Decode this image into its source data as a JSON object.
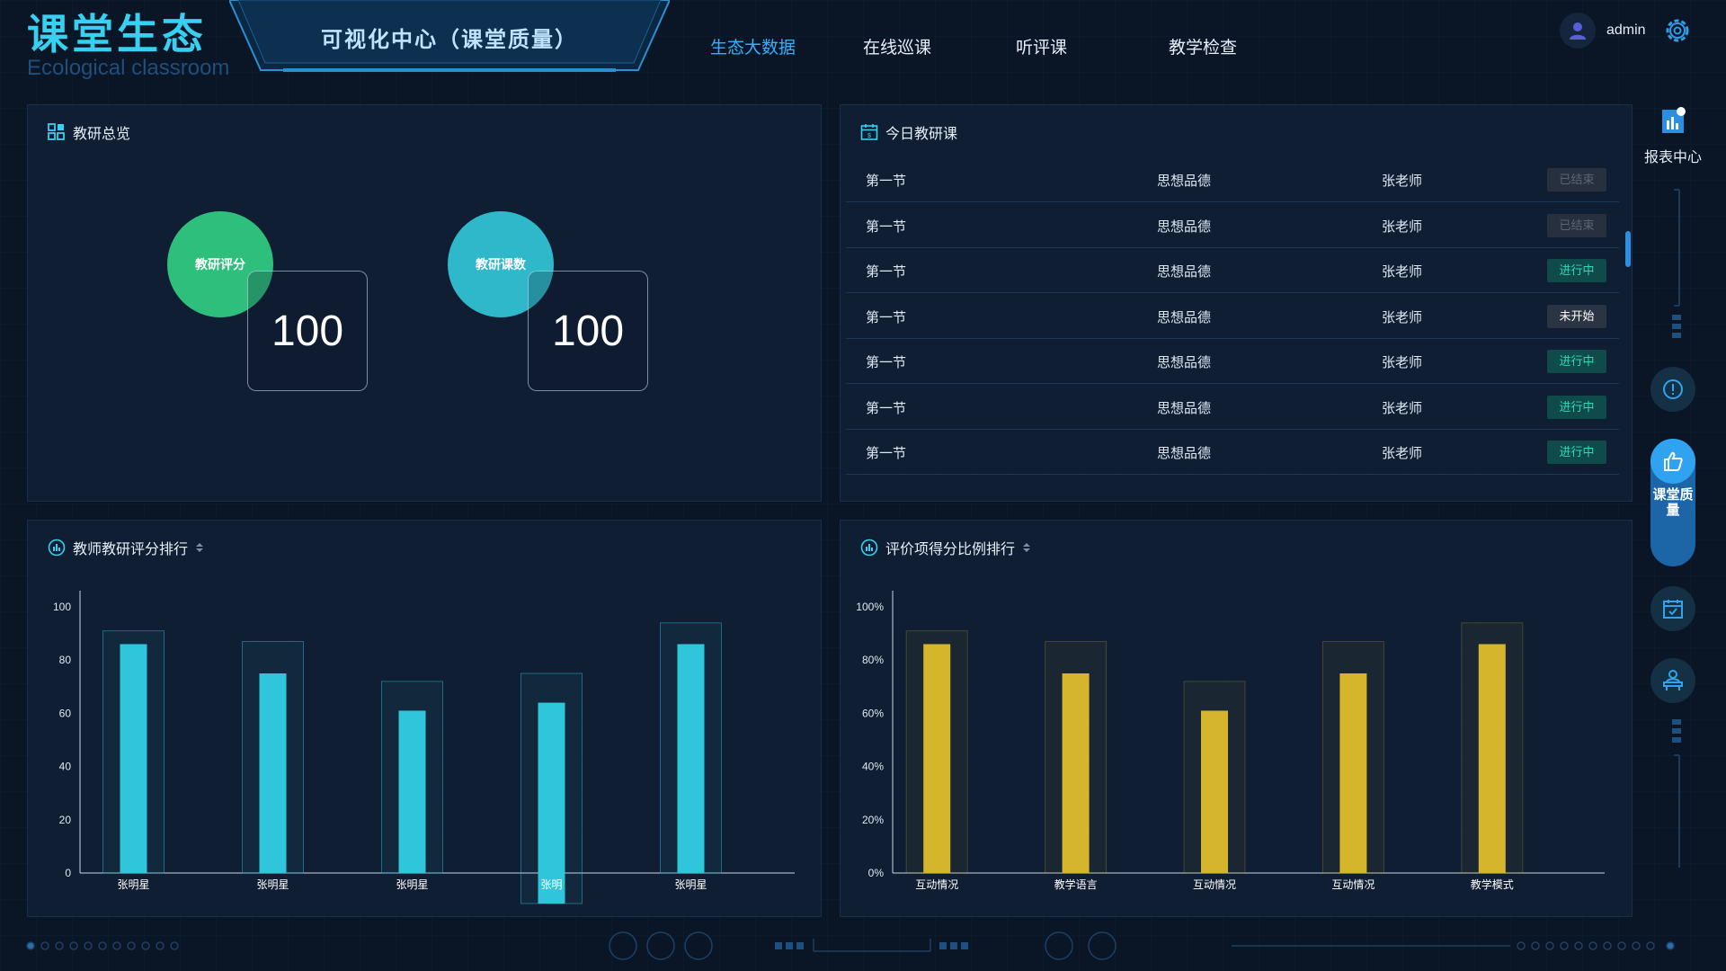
{
  "header": {
    "brand_title": "课堂生态",
    "brand_subtitle": "Ecological classroom",
    "center_title": "可视化中心（课堂质量）",
    "nav": [
      {
        "label": "生态大数据",
        "active": true
      },
      {
        "label": "在线巡课",
        "active": false
      },
      {
        "label": "听评课",
        "active": false
      },
      {
        "label": "教学检查",
        "active": false
      }
    ],
    "user_name": "admin"
  },
  "overview": {
    "title": "教研总览",
    "stats": [
      {
        "label": "教研评分",
        "value": "100",
        "color": "#2ebf7d"
      },
      {
        "label": "教研课数",
        "value": "100",
        "color": "#2fb8c9"
      }
    ]
  },
  "today": {
    "title": "今日教研课",
    "rows": [
      {
        "period": "第一节",
        "subject": "思想品德",
        "teacher": "张老师",
        "status": "已结束",
        "kind": "done"
      },
      {
        "period": "第一节",
        "subject": "思想品德",
        "teacher": "张老师",
        "status": "已结束",
        "kind": "done"
      },
      {
        "period": "第一节",
        "subject": "思想品德",
        "teacher": "张老师",
        "status": "进行中",
        "kind": "going"
      },
      {
        "period": "第一节",
        "subject": "思想品德",
        "teacher": "张老师",
        "status": "未开始",
        "kind": "wait"
      },
      {
        "period": "第一节",
        "subject": "思想品德",
        "teacher": "张老师",
        "status": "进行中",
        "kind": "going"
      },
      {
        "period": "第一节",
        "subject": "思想品德",
        "teacher": "张老师",
        "status": "进行中",
        "kind": "going"
      },
      {
        "period": "第一节",
        "subject": "思想品德",
        "teacher": "张老师",
        "status": "进行中",
        "kind": "going"
      }
    ]
  },
  "rail": {
    "report_label": "报表中心",
    "active_label": "课堂质量"
  },
  "colors": {
    "accent": "#2fb3ff",
    "cyan_bar": "#2fc6dc",
    "gold_bar": "#d4b52c"
  },
  "chart_data": [
    {
      "type": "bar",
      "title": "教师教研评分排行",
      "categories": [
        "张明星",
        "张明星",
        "张明星",
        "张明",
        "张明星"
      ],
      "values": [
        86,
        75,
        61,
        64,
        86
      ],
      "background_values": [
        91,
        87,
        72,
        75,
        94
      ],
      "yticks": [
        "0",
        "20",
        "40",
        "60",
        "80",
        "100"
      ],
      "ylim": [
        0,
        100
      ],
      "color": "#2fc6dc"
    },
    {
      "type": "bar",
      "title": "评价项得分比例排行",
      "categories": [
        "互动情况",
        "教学语言",
        "互动情况",
        "互动情况",
        "教学模式"
      ],
      "values": [
        86,
        75,
        61,
        75,
        86
      ],
      "background_values": [
        91,
        87,
        72,
        87,
        94
      ],
      "yticks": [
        "0%",
        "20%",
        "40%",
        "60%",
        "80%",
        "100%"
      ],
      "ylim": [
        0,
        100
      ],
      "color": "#d4b52c"
    }
  ]
}
